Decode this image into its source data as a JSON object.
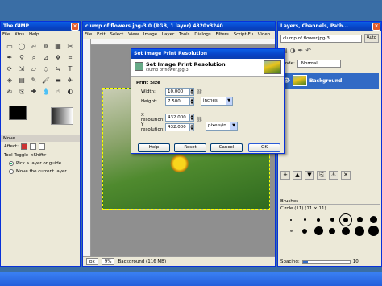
{
  "toolbox": {
    "title": "The GIMP",
    "menu": [
      "File",
      "Xtns",
      "Help"
    ],
    "options_header": "Move",
    "affect_label": "Affect:",
    "tool_toggle_label": "Tool Toggle <Shift>",
    "option_1": "Pick a layer or guide",
    "option_2": "Move the current layer"
  },
  "image_window": {
    "title": "clump of flowers.jpg-3.0 (RGB, 1 layer) 4320x3240",
    "menu": [
      "File",
      "Edit",
      "Select",
      "View",
      "Image",
      "Layer",
      "Tools",
      "Dialogs",
      "Filters",
      "Script-Fu",
      "Video"
    ],
    "unit": "px",
    "zoom": "9%",
    "status": "Background (116 MB)"
  },
  "layers": {
    "title": "Layers, Channels, Path...",
    "document": "clump of flower.jpg-3",
    "auto_label": "Auto",
    "mode_label": "Mode:",
    "mode_value": "Normal",
    "layer_name": "Background",
    "brushes_label": "Brushes",
    "brush_name": "Circle (11) (11 × 11)",
    "spacing_label": "Spacing:",
    "spacing_value": 10
  },
  "dialog": {
    "title": "Set Image Print Resolution",
    "header_title": "Set Image Print Resolution",
    "header_subtitle": "clump of flower.jpg-3",
    "section": "Print Size",
    "width_label": "Width:",
    "width_value": "10.000",
    "height_label": "Height:",
    "height_value": "7.500",
    "size_unit": "inches",
    "xres_label": "X resolution:",
    "xres_value": "432.000",
    "yres_label": "Y resolution:",
    "yres_value": "432.000",
    "res_unit": "pixels/in",
    "help_btn": "Help",
    "reset_btn": "Reset",
    "cancel_btn": "Cancel",
    "ok_btn": "OK"
  }
}
